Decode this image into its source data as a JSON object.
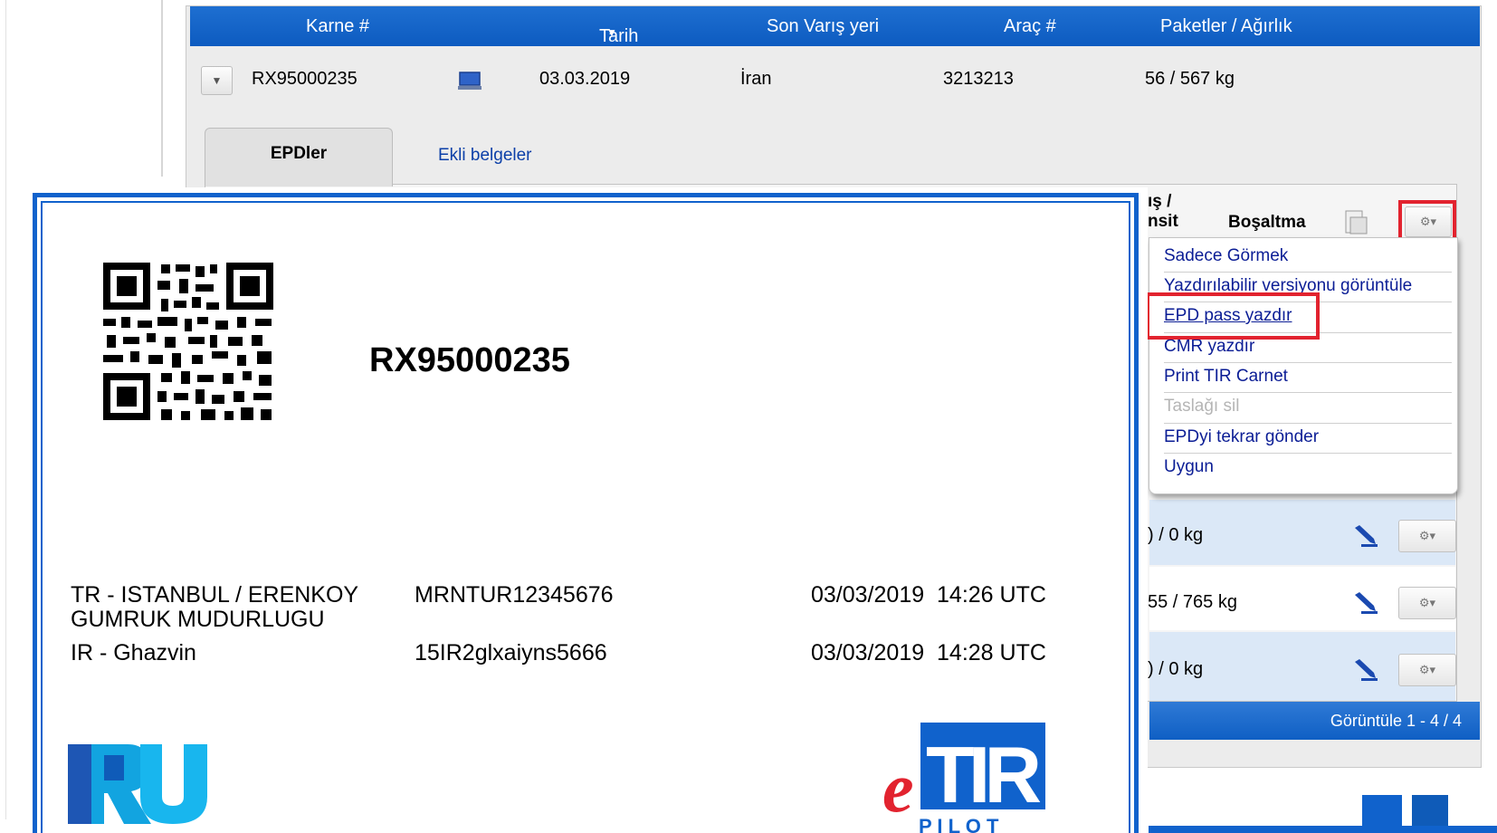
{
  "grid": {
    "headers": {
      "carnet": "Karne #",
      "date": "Tarih",
      "date_sort_icon": "sort-desc-caret",
      "destination": "Son Varış yeri",
      "vehicle": "Araç #",
      "packages": "Paketler / Ağırlık"
    },
    "row": {
      "carnet": "RX95000235",
      "date": "03.03.2019",
      "destination": "İran",
      "vehicle": "3213213",
      "packages": "56 / 567 kg"
    },
    "tabs": [
      "EPDler",
      "Ekli belgeler"
    ],
    "inner": {
      "header_partial_1": "ış /",
      "header_partial_2": "nsit",
      "header_unload": "Boşaltma",
      "rows": [
        {
          "value": ") / 0 kg"
        },
        {
          "value": "55 / 765 kg"
        },
        {
          "value": ") / 0 kg"
        }
      ]
    },
    "footer": "Görüntüle 1 - 4 / 4"
  },
  "menu": {
    "items": [
      {
        "label": "Sadece Görmek",
        "enabled": true
      },
      {
        "label": "Yazdırılabilir versiyonu görüntüle",
        "enabled": true
      },
      {
        "label": "EPD pass yazdır",
        "enabled": true
      },
      {
        "label": "CMR yazdır",
        "enabled": true
      },
      {
        "label": "Print TIR Carnet",
        "enabled": true
      },
      {
        "label": "Taslağı sil",
        "enabled": false
      },
      {
        "label": "EPDyi tekrar gönder",
        "enabled": true
      },
      {
        "label": "Uygun",
        "enabled": true
      }
    ],
    "highlight_color": "#e2232f"
  },
  "document": {
    "id": "RX95000235",
    "rows": [
      {
        "office": "TR - ISTANBUL / ERENKOY",
        "office2": "GUMRUK MUDURLUGU",
        "ref": "MRNTUR12345676",
        "datetime": "03/03/2019  14:26 UTC"
      },
      {
        "office": "IR - Ghazvin",
        "ref": "15IR2glxaiyns5666",
        "datetime": "03/03/2019  14:28 UTC"
      }
    ],
    "logo_left": "IRU",
    "logo_right_e": "e",
    "logo_right_main": "TIR",
    "logo_right_sub": "P I L O T"
  },
  "colors": {
    "header_blue": "#0d5bc0",
    "row_blue": "#dbe8f7",
    "link_navy": "#0b1d95",
    "doc_border": "#1062cc"
  }
}
